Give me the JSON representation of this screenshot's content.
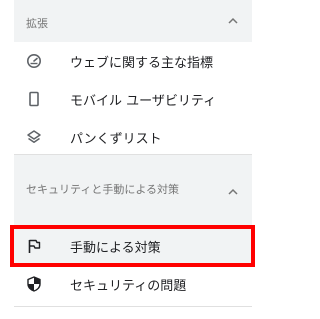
{
  "sections": [
    {
      "title": "拡張",
      "expanded": true,
      "items": [
        {
          "label": "ウェブに関する主な指標",
          "icon": "gauge-icon"
        },
        {
          "label": "モバイル ユーザビリティ",
          "icon": "smartphone-icon"
        },
        {
          "label": "パンくずリスト",
          "icon": "layers-diamond-icon"
        }
      ]
    },
    {
      "title": "セキュリティと手動による対策",
      "expanded": true,
      "items": [
        {
          "label": "手動による対策",
          "icon": "flag-icon",
          "selected": true
        },
        {
          "label": "セキュリティの問題",
          "icon": "shield-icon"
        }
      ]
    }
  ],
  "colors": {
    "section_header_bg": "#f1f3f4",
    "selected_bg": "#f1f3f4",
    "highlight_border": "#ff0000",
    "text": "#202124",
    "muted_text": "#757575"
  }
}
